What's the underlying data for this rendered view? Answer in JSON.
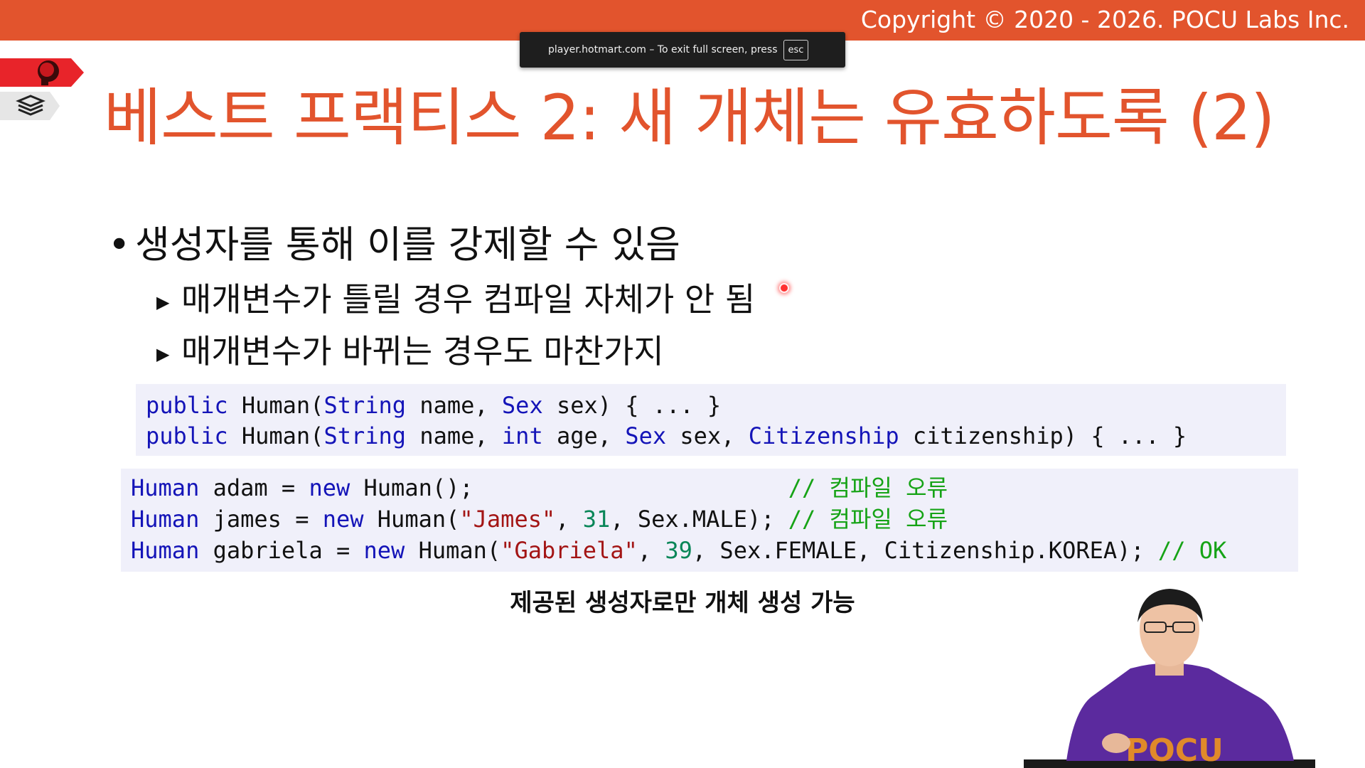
{
  "header": {
    "copyright": "Copyright © 2020 - 2026. POCU Labs Inc.",
    "fullscreen_notice": "player.hotmart.com – To exit full screen, press",
    "esc_key": "esc"
  },
  "slide": {
    "title": "베스트 프랙티스 2: 새 개체는 유효하도록 (2)",
    "bullet": "생성자를 통해 이를 강제할 수 있음",
    "sub_bullets": [
      "매개변수가 틀릴 경우 컴파일 자체가 안 됨",
      "매개변수가 바뀌는 경우도 마찬가지"
    ],
    "caption": "제공된 생성자로만 개체 생성 가능",
    "presenter_logo": "POCU"
  },
  "code_block_1": {
    "line1": {
      "kw": "public",
      "cls": " Human(",
      "t1": "String",
      "a1": " name, ",
      "t2": "Sex",
      "a2": " sex) { ... }"
    },
    "line2": {
      "kw": "public",
      "cls": " Human(",
      "t1": "String",
      "a1": " name, ",
      "t2": "int",
      "a2": " age, ",
      "t3": "Sex",
      "a3": " sex, ",
      "t4": "Citizenship",
      "a4": " citizenship) { ... }"
    }
  },
  "code_block_2": {
    "line1": {
      "t": "Human",
      "a": " adam = ",
      "kw": "new",
      "b": " Human();",
      "pad": "                       ",
      "cm": "// 컴파일 오류"
    },
    "line2": {
      "t": "Human",
      "a": " james = ",
      "kw": "new",
      "b": " Human(",
      "s": "\"James\"",
      "c": ", ",
      "n": "31",
      "d": ", Sex.MALE); ",
      "cm": "// 컴파일 오류"
    },
    "line3": {
      "t": "Human",
      "a": " gabriela = ",
      "kw": "new",
      "b": " Human(",
      "s": "\"Gabriela\"",
      "c": ", ",
      "n": "39",
      "d": ", Sex.FEMALE, Citizenship.KOREA); ",
      "cm": "// OK"
    }
  },
  "colors": {
    "accent": "#e2542d",
    "keyword": "#1414b8",
    "string": "#a31515",
    "number": "#098658",
    "comment": "#16a316",
    "code_bg": "#f0f0fa"
  }
}
